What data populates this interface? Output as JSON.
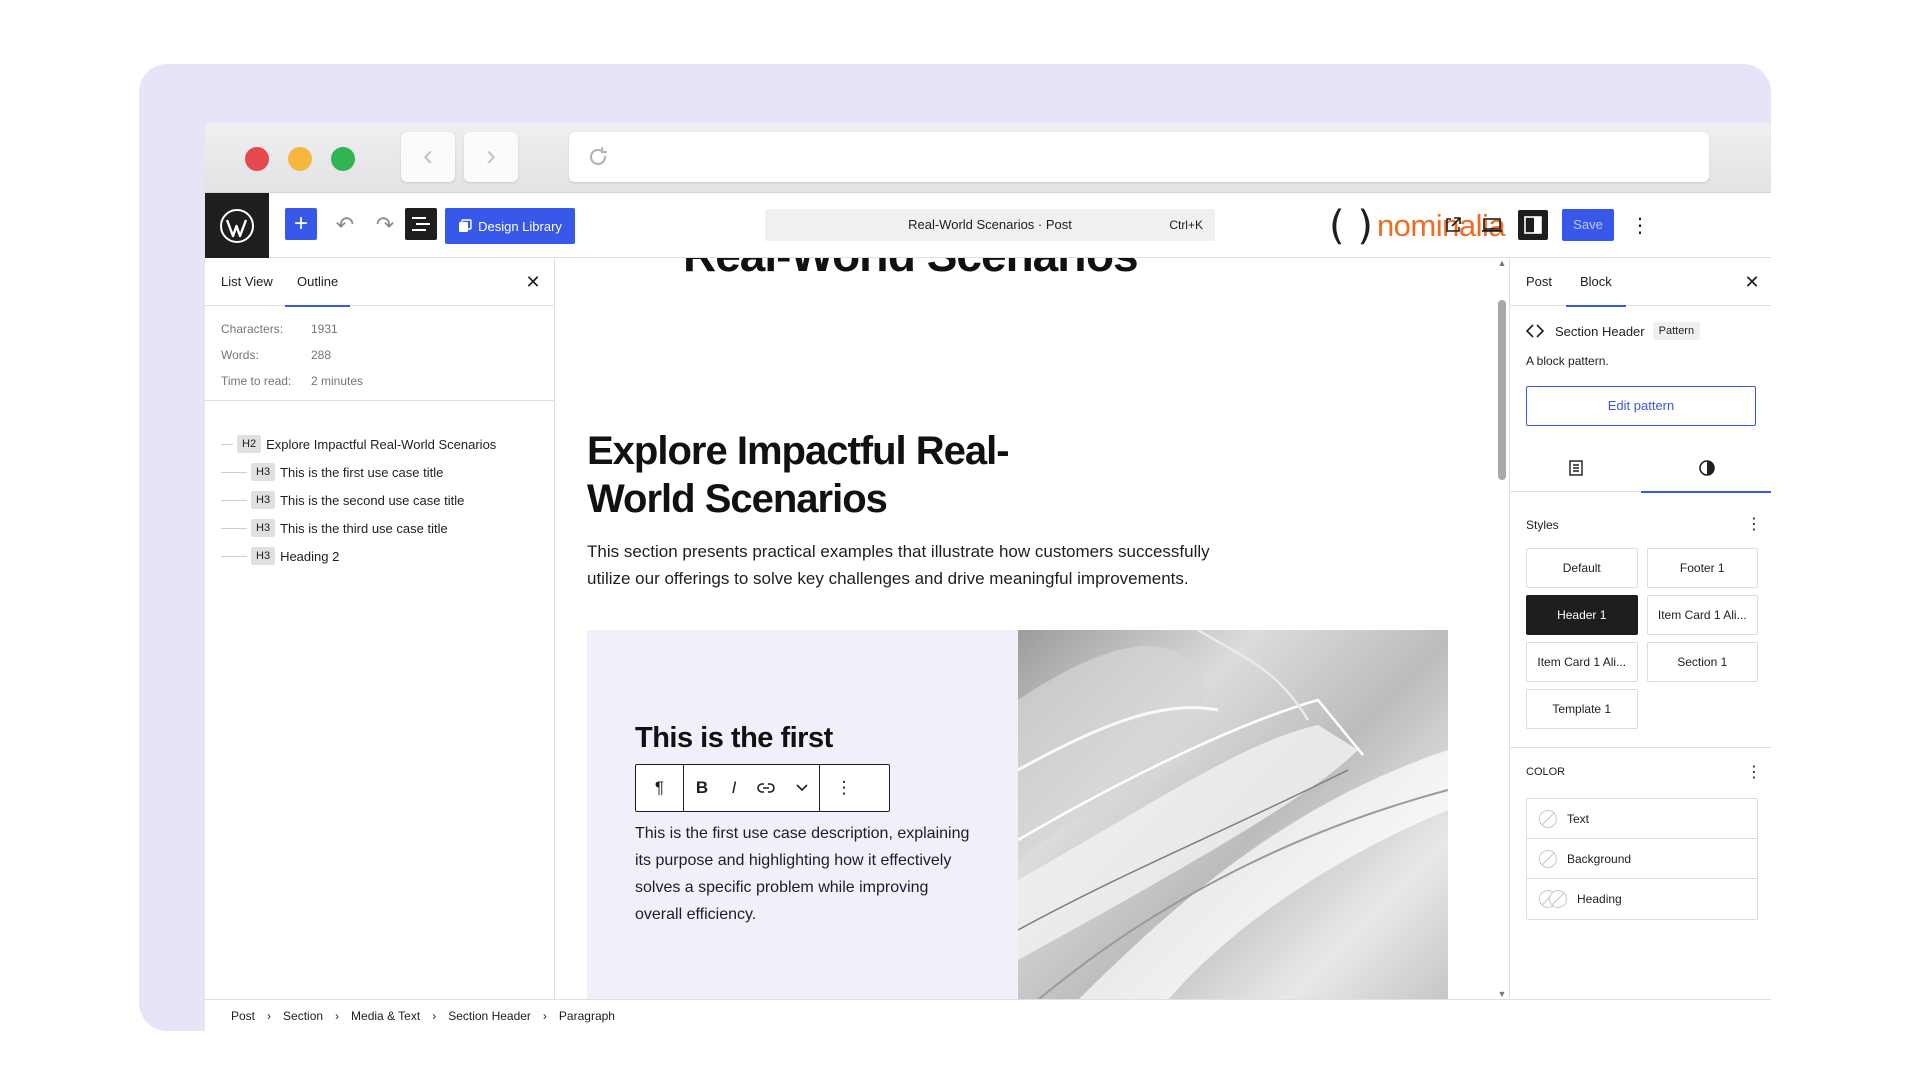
{
  "toolbar": {
    "design_library": "Design Library",
    "command_title": "Real-World Scenarios · Post",
    "command_shortcut": "Ctrl+K",
    "brand_paren": "( )",
    "brand_name": "nominalia",
    "save": "Save",
    "accent": "#3858e9",
    "brand_color": "#f26c1f"
  },
  "left_panel": {
    "tabs": [
      "List View",
      "Outline"
    ],
    "active_tab": "Outline",
    "stats": [
      {
        "label": "Characters:",
        "value": "1931"
      },
      {
        "label": "Words:",
        "value": "288"
      },
      {
        "label": "Time to read:",
        "value": "2 minutes"
      }
    ],
    "outline": [
      {
        "level": "H2",
        "text": "Explore Impactful Real-World Scenarios"
      },
      {
        "level": "H3",
        "text": "This is the first use case title"
      },
      {
        "level": "H3",
        "text": "This is the second use case title"
      },
      {
        "level": "H3",
        "text": "This is the third use case title"
      },
      {
        "level": "H3",
        "text": "Heading 2"
      }
    ]
  },
  "canvas": {
    "cut_title": "Real-World Scenarios",
    "section_title": "Explore Impactful Real-World Scenarios",
    "section_desc": "This section presents practical examples that illustrate how customers successfully utilize our offerings to solve key challenges and drive meaningful improvements.",
    "card_title": "This is the first",
    "card_desc": "This is the first use case description, explaining its purpose and highlighting how it effectively solves a specific problem while improving overall efficiency.",
    "inline_toolbar": {
      "paragraph": "¶",
      "bold": "B",
      "italic": "I",
      "more": "⋮"
    }
  },
  "right_panel": {
    "tabs": [
      "Post",
      "Block"
    ],
    "active_tab": "Block",
    "block_name": "Section Header",
    "block_badge": "Pattern",
    "block_desc": "A block pattern.",
    "edit_pattern": "Edit pattern",
    "styles_title": "Styles",
    "styles": [
      "Default",
      "Footer 1",
      "Header 1",
      "Item Card 1 Ali...",
      "Item Card 1 Ali...",
      "Section 1",
      "Template 1"
    ],
    "active_style": "Header 1",
    "color_title": "Color",
    "colors": [
      "Text",
      "Background",
      "Heading"
    ]
  },
  "breadcrumb": [
    "Post",
    "Section",
    "Media & Text",
    "Section Header",
    "Paragraph"
  ]
}
